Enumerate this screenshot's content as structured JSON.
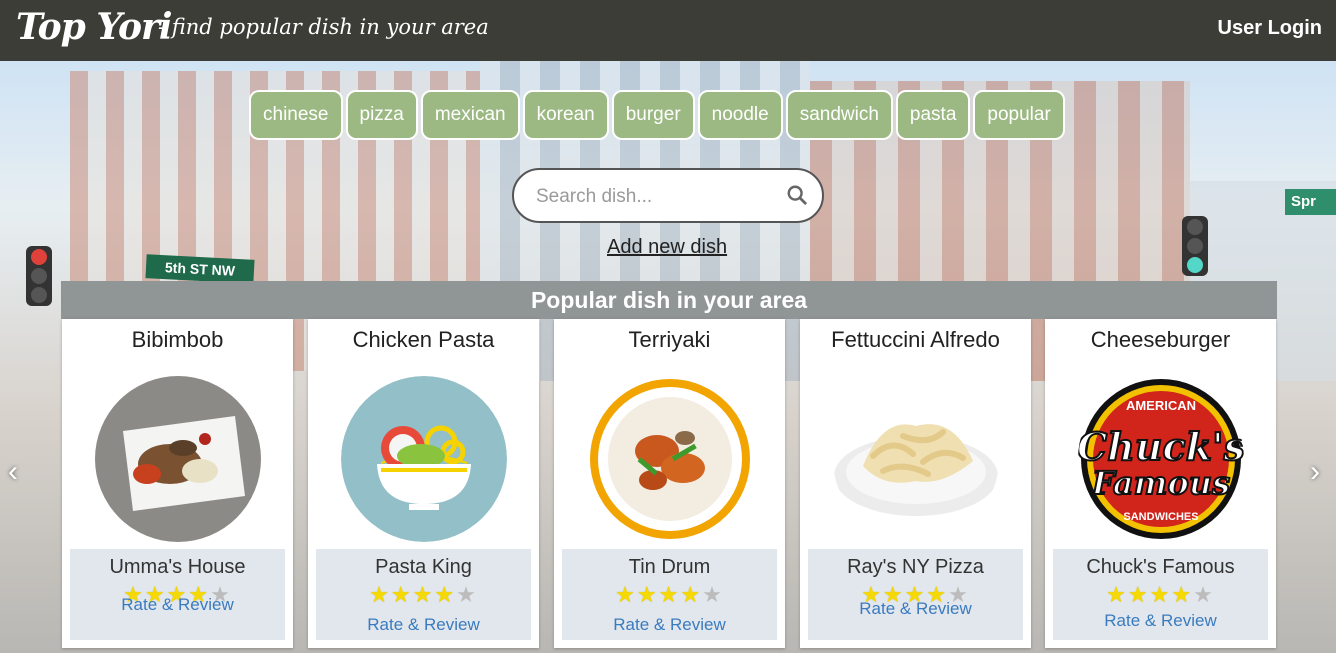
{
  "nav": {
    "brand": "Top Yori",
    "tagline": "- find popular dish in your area",
    "login": "User Login"
  },
  "hero": {
    "street_sign_left": "5th ST NW",
    "street_sign_right": "Spr"
  },
  "tags": [
    "chinese",
    "pizza",
    "mexican",
    "korean",
    "burger",
    "noodle",
    "sandwich",
    "pasta",
    "popular"
  ],
  "search": {
    "placeholder": "Search dish...",
    "icon": "search-icon"
  },
  "add_dish": "Add new dish",
  "section_title": "Popular dish in your area",
  "cards": [
    {
      "dish": "Bibimbob",
      "restaurant": "Umma's House",
      "rating": 4,
      "review": "Rate & Review",
      "image": "bibimbap-plate"
    },
    {
      "dish": "Chicken Pasta",
      "restaurant": "Pasta King",
      "rating": 4,
      "review": "Rate & Review",
      "image": "salad-bowl-icon"
    },
    {
      "dish": "Terriyaki",
      "restaurant": "Tin Drum",
      "rating": 4,
      "review": "Rate & Review",
      "image": "teriyaki-bowl"
    },
    {
      "dish": "Fettuccini Alfredo",
      "restaurant": "Ray's NY Pizza",
      "rating": 4,
      "review": "Rate & Review",
      "image": "fettuccine-plate"
    },
    {
      "dish": "Cheeseburger",
      "restaurant": "Chuck's Famous",
      "rating": 4,
      "review": "Rate & Review",
      "image": "chucks-famous-logo"
    }
  ],
  "logo_text": {
    "top": "AMERICAN",
    "main1": "Chuck's",
    "main2": "Famous",
    "bottom": "SANDWICHES"
  },
  "carousel": {
    "prev": "‹",
    "next": "›"
  },
  "colors": {
    "navbar": "#3d3d37",
    "tag": "#9cb983",
    "header": "#909595",
    "link": "#3a7bbf",
    "star": "#f5d900"
  }
}
